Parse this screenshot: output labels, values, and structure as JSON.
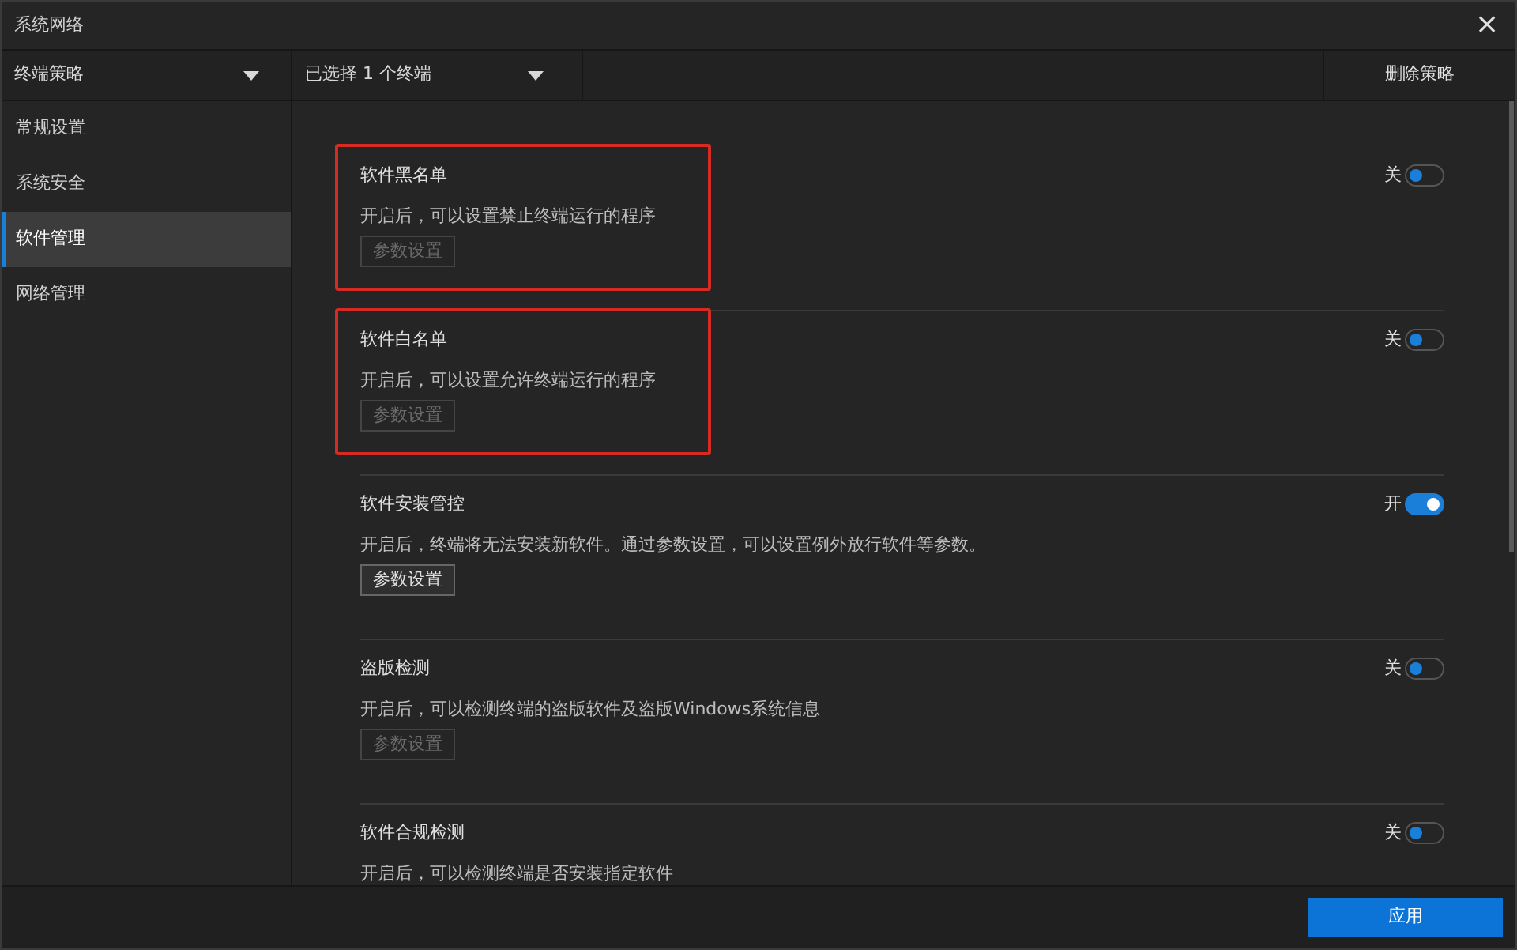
{
  "window": {
    "title": "系统网络",
    "close": "×"
  },
  "toolbar": {
    "policy_dropdown": "终端策略",
    "terminal_dropdown": "已选择 1 个终端",
    "delete_button": "删除策略"
  },
  "sidebar": {
    "items": [
      {
        "label": "常规设置",
        "selected": false
      },
      {
        "label": "系统安全",
        "selected": false
      },
      {
        "label": "软件管理",
        "selected": true
      },
      {
        "label": "网络管理",
        "selected": false
      }
    ]
  },
  "sections": [
    {
      "title": "软件黑名单",
      "description": "开启后，可以设置禁止终端运行的程序",
      "button": {
        "label": "参数设置",
        "disabled": true
      },
      "toggle": {
        "label": "关",
        "on": false
      },
      "highlighted": true
    },
    {
      "title": "软件白名单",
      "description": "开启后，可以设置允许终端运行的程序",
      "button": {
        "label": "参数设置",
        "disabled": true
      },
      "toggle": {
        "label": "关",
        "on": false
      },
      "highlighted": true
    },
    {
      "title": "软件安装管控",
      "description": "开启后，终端将无法安装新软件。通过参数设置，可以设置例外放行软件等参数。",
      "button": {
        "label": "参数设置",
        "disabled": false
      },
      "toggle": {
        "label": "开",
        "on": true
      },
      "highlighted": false
    },
    {
      "title": "盗版检测",
      "description": "开启后，可以检测终端的盗版软件及盗版Windows系统信息",
      "button": {
        "label": "参数设置",
        "disabled": true
      },
      "toggle": {
        "label": "关",
        "on": false
      },
      "highlighted": false
    },
    {
      "title": "软件合规检测",
      "description": "开启后，可以检测终端是否安装指定软件",
      "toggle": {
        "label": "关",
        "on": false
      },
      "highlighted": false
    }
  ],
  "footer": {
    "apply_button": "应用"
  }
}
